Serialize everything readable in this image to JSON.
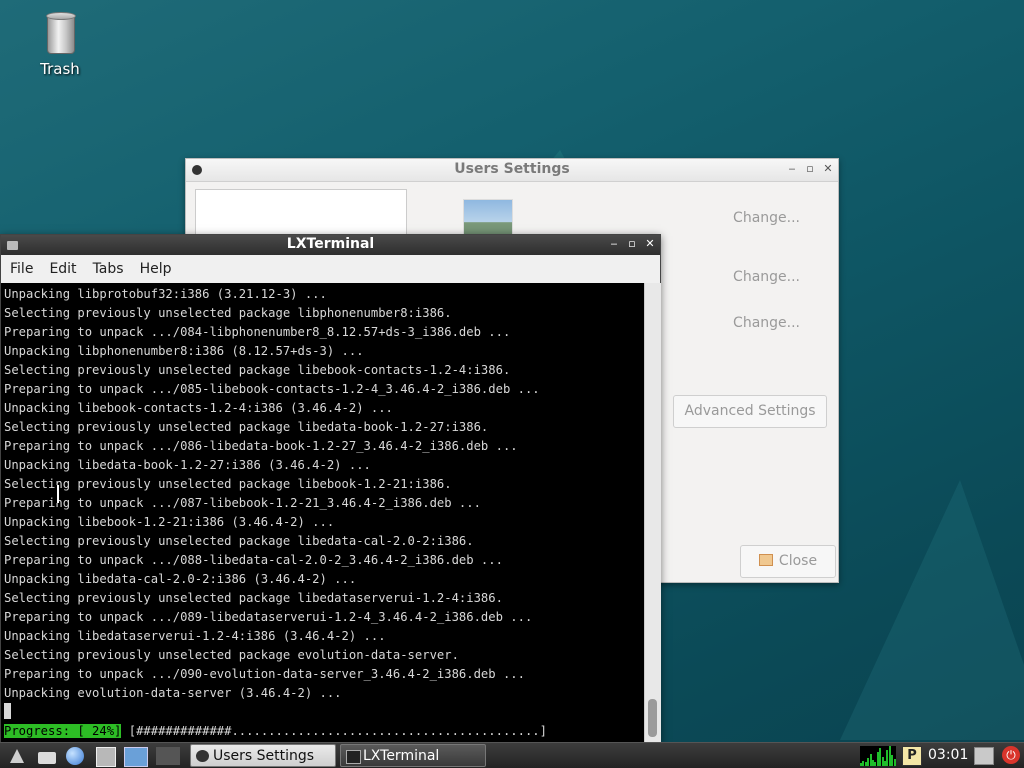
{
  "desktop": {
    "icons": [
      {
        "label": "Trash",
        "icon": "trash-icon"
      }
    ]
  },
  "users_settings": {
    "title": "Users Settings",
    "change_1": "Change...",
    "change_2": "Change...",
    "change_3": "Change...",
    "advanced_settings": "Advanced Settings",
    "close": "Close"
  },
  "terminal": {
    "title": "LXTerminal",
    "menu": [
      "File",
      "Edit",
      "Tabs",
      "Help"
    ],
    "lines": [
      "Unpacking libprotobuf32:i386 (3.21.12-3) ...",
      "Selecting previously unselected package libphonenumber8:i386.",
      "Preparing to unpack .../084-libphonenumber8_8.12.57+ds-3_i386.deb ...",
      "Unpacking libphonenumber8:i386 (8.12.57+ds-3) ...",
      "Selecting previously unselected package libebook-contacts-1.2-4:i386.",
      "Preparing to unpack .../085-libebook-contacts-1.2-4_3.46.4-2_i386.deb ...",
      "Unpacking libebook-contacts-1.2-4:i386 (3.46.4-2) ...",
      "Selecting previously unselected package libedata-book-1.2-27:i386.",
      "Preparing to unpack .../086-libedata-book-1.2-27_3.46.4-2_i386.deb ...",
      "Unpacking libedata-book-1.2-27:i386 (3.46.4-2) ...",
      "Selecting previously unselected package libebook-1.2-21:i386.",
      "Preparing to unpack .../087-libebook-1.2-21_3.46.4-2_i386.deb ...",
      "Unpacking libebook-1.2-21:i386 (3.46.4-2) ...",
      "Selecting previously unselected package libedata-cal-2.0-2:i386.",
      "Preparing to unpack .../088-libedata-cal-2.0-2_3.46.4-2_i386.deb ...",
      "Unpacking libedata-cal-2.0-2:i386 (3.46.4-2) ...",
      "Selecting previously unselected package libedataserverui-1.2-4:i386.",
      "Preparing to unpack .../089-libedataserverui-1.2-4_3.46.4-2_i386.deb ...",
      "Unpacking libedataserverui-1.2-4:i386 (3.46.4-2) ...",
      "Selecting previously unselected package evolution-data-server.",
      "Preparing to unpack .../090-evolution-data-server_3.46.4-2_i386.deb ...",
      "Unpacking evolution-data-server (3.46.4-2) ..."
    ],
    "progress_label": "Progress: [ 24%]",
    "progress_bar": " [#############..........................................] "
  },
  "taskbar": {
    "tasks": [
      {
        "label": "Users Settings",
        "active": true
      },
      {
        "label": "LXTerminal",
        "active": false
      }
    ],
    "tray_p": "P",
    "clock": "03:01"
  },
  "colors": {
    "progress_green": "#2dbd25",
    "terminal_bg": "#000000",
    "desktop_teal": "#14606e"
  }
}
